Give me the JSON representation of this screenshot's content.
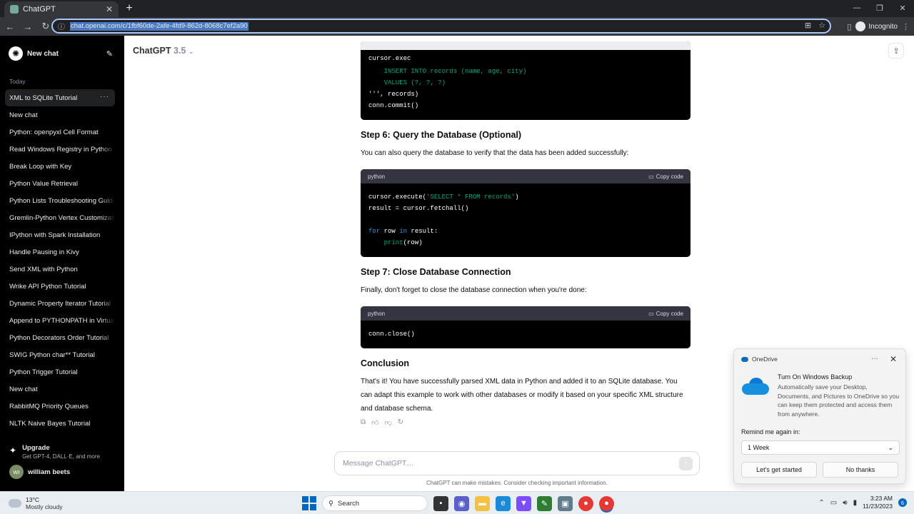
{
  "browser": {
    "tab_title": "ChatGPT",
    "url": "chat.openai.com/c/1fbf60de-2afe-4fd9-862d-8068c7ef2a90",
    "profile_label": "Incognito"
  },
  "sidebar": {
    "new_chat_label": "New chat",
    "section_today": "Today",
    "items": [
      {
        "label": "XML to SQLite Tutorial"
      },
      {
        "label": "New chat"
      },
      {
        "label": "Python: openpyxl Cell Format"
      },
      {
        "label": "Read Windows Registry in Python"
      },
      {
        "label": "Break Loop with Key"
      },
      {
        "label": "Python Value Retrieval"
      },
      {
        "label": "Python Lists Troubleshooting Guide"
      },
      {
        "label": "Gremlin-Python Vertex Customization"
      },
      {
        "label": "IPython with Spark Installation"
      },
      {
        "label": "Handle Pausing in Kivy"
      },
      {
        "label": "Send XML with Python"
      },
      {
        "label": "Wrike API Python Tutorial"
      },
      {
        "label": "Dynamic Property Iterator Tutorial"
      },
      {
        "label": "Append to PYTHONPATH in Virtualenv"
      },
      {
        "label": "Python Decorators Order Tutorial"
      },
      {
        "label": "SWIG Python char** Tutorial"
      },
      {
        "label": "Python Trigger Tutorial"
      },
      {
        "label": "New chat"
      },
      {
        "label": "RabbitMQ Priority Queues"
      },
      {
        "label": "NLTK Naive Bayes Tutorial"
      }
    ],
    "upgrade_title": "Upgrade",
    "upgrade_sub": "Get GPT-4, DALL·E, and more",
    "user_initials": "WI",
    "user_name": "william beets"
  },
  "header": {
    "model_name": "ChatGPT",
    "model_version": "3.5"
  },
  "content": {
    "code1_lines": [
      "    INSERT INTO records (name, age, city)",
      "    VALUES (?, ?, ?)",
      "''', records)",
      "conn.commit()"
    ],
    "step6_heading": "Step 6: Query the Database (Optional)",
    "step6_text": "You can also query the database to verify that the data has been added successfully:",
    "code_lang": "python",
    "copy_label": "Copy code",
    "step7_heading": "Step 7: Close Database Connection",
    "step7_text": "Finally, don't forget to close the database connection when you're done:",
    "conclusion_heading": "Conclusion",
    "conclusion_text": "That's it! You have successfully parsed XML data in Python and added it to an SQLite database. You can adapt this example to work with other databases or modify it based on your specific XML structure and database schema."
  },
  "input": {
    "placeholder": "Message ChatGPT…",
    "disclaimer": "ChatGPT can make mistakes. Consider checking important information."
  },
  "toast": {
    "app_name": "OneDrive",
    "title": "Turn On Windows Backup",
    "text": "Automatically save your Desktop, Documents, and Pictures to OneDrive so you can keep them protected and access them from anywhere.",
    "remind_label": "Remind me again in:",
    "remind_value": "1 Week",
    "primary_button": "Let's get started",
    "secondary_button": "No thanks"
  },
  "taskbar": {
    "temperature": "13°C",
    "weather": "Mostly cloudy",
    "search_label": "Search",
    "time": "3:23 AM",
    "date": "11/23/2023",
    "notification_count": "6"
  }
}
